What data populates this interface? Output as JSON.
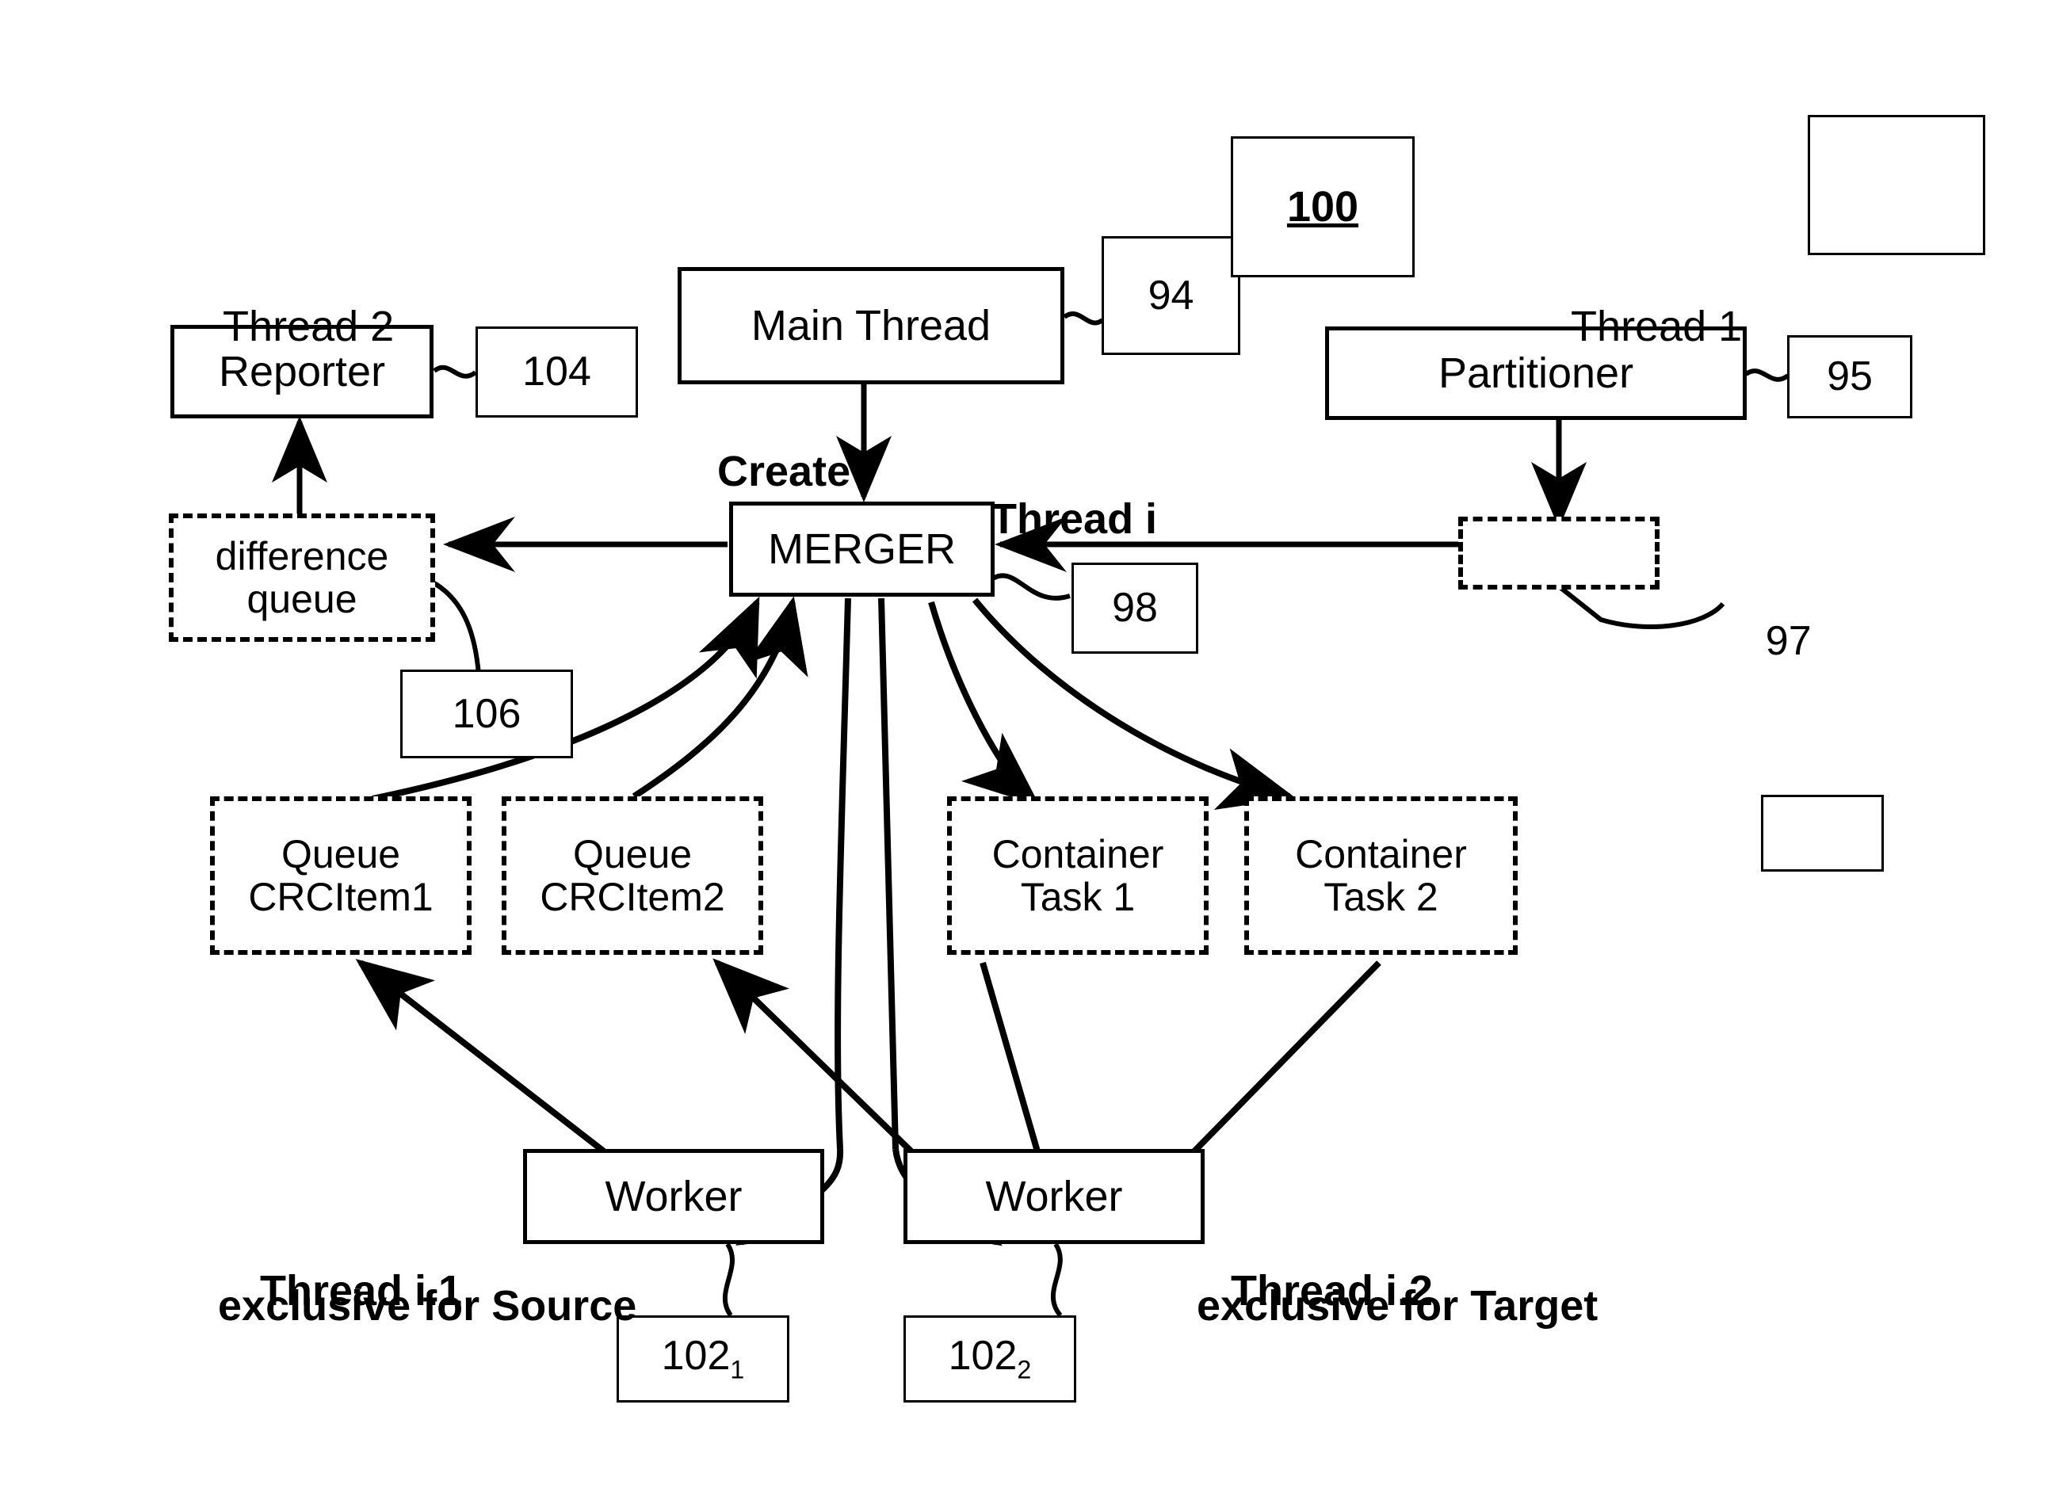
{
  "figure": {
    "ref_number": "100"
  },
  "nodes": {
    "main_thread": {
      "label": "Main Thread",
      "ref": "94"
    },
    "merger": {
      "label": "MERGER",
      "ref": "98"
    },
    "reporter": {
      "label": "Reporter",
      "ref": "104"
    },
    "partitioner": {
      "label": "Partitioner",
      "ref": "95"
    },
    "difference_queue": {
      "label": "difference\nqueue",
      "ref": "106"
    },
    "partition_queue": {
      "label": "",
      "ref": "97"
    },
    "queue_crcitem1": {
      "label": "Queue\nCRCItem1"
    },
    "queue_crcitem2": {
      "label": "Queue\nCRCItem2"
    },
    "container_task1": {
      "label": "Container\nTask 1"
    },
    "container_task2": {
      "label": "Container\nTask 2"
    },
    "worker_source": {
      "label": "Worker",
      "ref": "102",
      "ref_sub": "1"
    },
    "worker_target": {
      "label": "Worker",
      "ref": "102",
      "ref_sub": "2"
    }
  },
  "annotations": {
    "thread2": "Thread 2",
    "thread1": "Thread 1",
    "thread_i": "Thread i",
    "create": "Create",
    "thread_i1_line1": "Thread i.1",
    "thread_i1_line2": "exclusive for Source",
    "thread_i2_line1": "Thread i.2",
    "thread_i2_line2": "exclusive for Target"
  },
  "empty_boxes": {
    "top_right": "",
    "mid_right": ""
  },
  "colors": {
    "ink": "#000000",
    "paper": "#ffffff"
  }
}
